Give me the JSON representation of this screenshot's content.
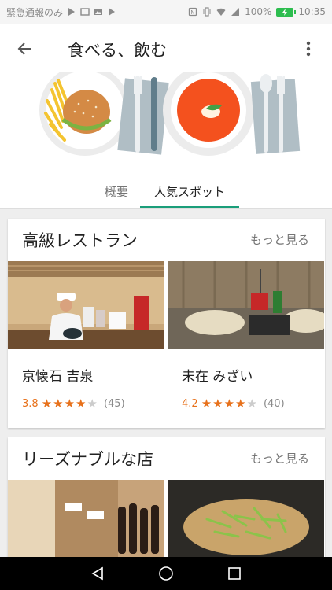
{
  "status_bar": {
    "notification_text": "緊急通報のみ",
    "battery_percent": "100%",
    "time": "10:35"
  },
  "header": {
    "title": "食べる、飲む",
    "back_icon": "arrow-left-icon",
    "more_icon": "more-vert-icon"
  },
  "tabs": [
    {
      "label": "概要",
      "selected": false
    },
    {
      "label": "人気スポット",
      "selected": true
    }
  ],
  "sections": [
    {
      "title": "高級レストラン",
      "see_more": "もっと見る",
      "places": [
        {
          "name": "京懐石 吉泉",
          "rating": "3.8",
          "rating_value": 3.8,
          "reviews": "(45)"
        },
        {
          "name": "未在 みざい",
          "rating": "4.2",
          "rating_value": 4.2,
          "reviews": "(40)"
        }
      ]
    },
    {
      "title": "リーズナブルな店",
      "see_more": "もっと見る",
      "places": []
    }
  ],
  "nav_bar": {
    "back_icon": "triangle-back-icon",
    "home_icon": "circle-home-icon",
    "recents_icon": "square-recents-icon"
  },
  "colors": {
    "accent": "#1a9e7a",
    "star": "#e7711b",
    "battery": "#2dbd4f"
  }
}
